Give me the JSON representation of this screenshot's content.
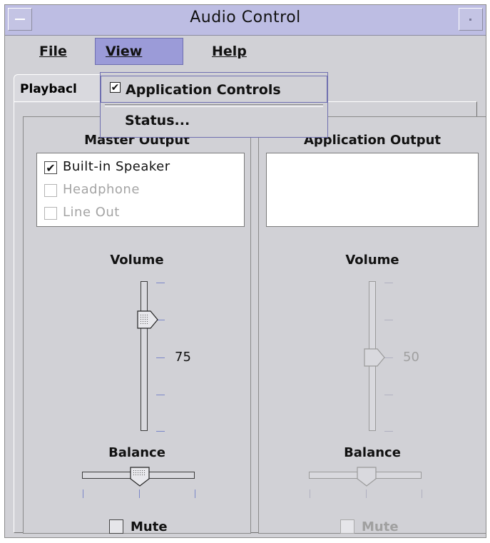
{
  "window": {
    "title": "Audio Control"
  },
  "menubar": {
    "file": "File",
    "view": "View",
    "help": "Help"
  },
  "view_menu": {
    "items": [
      {
        "label": "Application Controls",
        "checked": true
      },
      {
        "label": "Status..."
      }
    ]
  },
  "tabs": {
    "playback": "Playbacl"
  },
  "master": {
    "title": "Master Output",
    "outputs": [
      {
        "label": "Built-in Speaker",
        "checked": true,
        "enabled": true
      },
      {
        "label": "Headphone",
        "checked": false,
        "enabled": false
      },
      {
        "label": "Line Out",
        "checked": false,
        "enabled": false
      }
    ],
    "volume_label": "Volume",
    "volume_value": "75",
    "balance_label": "Balance",
    "mute_label": "Mute"
  },
  "application": {
    "title": "Application Output",
    "volume_label": "Volume",
    "volume_value": "50",
    "balance_label": "Balance",
    "mute_label": "Mute"
  },
  "colors": {
    "menu_highlight": "#9b9bd8",
    "titlebar": "#bdbde3",
    "background": "#d1d1d6",
    "tick": "#7a86c8"
  }
}
